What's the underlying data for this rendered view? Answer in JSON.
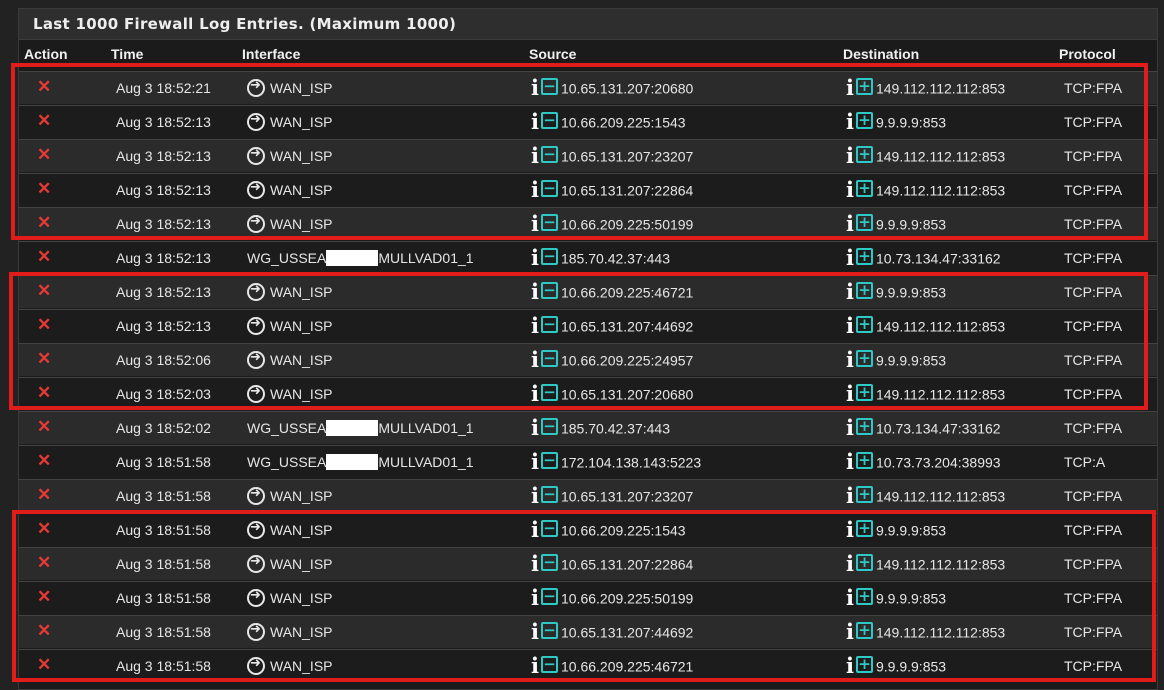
{
  "panel": {
    "title": "Last 1000 Firewall Log Entries. (Maximum 1000)"
  },
  "columns": {
    "action": "Action",
    "time": "Time",
    "interface": "Interface",
    "source": "Source",
    "destination": "Destination",
    "protocol": "Protocol"
  },
  "icons": {
    "action": "block-x-icon",
    "interface": "arrow-circle-icon",
    "info": "info-icon",
    "source": "minus-box-icon",
    "destination": "plus-box-icon"
  },
  "colors": {
    "block": "#e53935",
    "accent": "#2ec9c4",
    "highlight": "#e21b1b"
  },
  "rows": [
    {
      "time": "Aug 3 18:52:21",
      "iface": "WAN_ISP",
      "src": "10.65.131.207:20680",
      "dst": "149.112.112.112:853",
      "proto": "TCP:FPA"
    },
    {
      "time": "Aug 3 18:52:13",
      "iface": "WAN_ISP",
      "src": "10.66.209.225:1543",
      "dst": "9.9.9.9:853",
      "proto": "TCP:FPA"
    },
    {
      "time": "Aug 3 18:52:13",
      "iface": "WAN_ISP",
      "src": "10.65.131.207:23207",
      "dst": "149.112.112.112:853",
      "proto": "TCP:FPA"
    },
    {
      "time": "Aug 3 18:52:13",
      "iface": "WAN_ISP",
      "src": "10.65.131.207:22864",
      "dst": "149.112.112.112:853",
      "proto": "TCP:FPA"
    },
    {
      "time": "Aug 3 18:52:13",
      "iface": "WAN_ISP",
      "src": "10.66.209.225:50199",
      "dst": "9.9.9.9:853",
      "proto": "TCP:FPA"
    },
    {
      "time": "Aug 3 18:52:13",
      "iface_a": "WG_USSEA",
      "iface_b": "MULLVAD01_1",
      "src": "185.70.42.37:443",
      "dst": "10.73.134.47:33162",
      "proto": "TCP:FPA"
    },
    {
      "time": "Aug 3 18:52:13",
      "iface": "WAN_ISP",
      "src": "10.66.209.225:46721",
      "dst": "9.9.9.9:853",
      "proto": "TCP:FPA"
    },
    {
      "time": "Aug 3 18:52:13",
      "iface": "WAN_ISP",
      "src": "10.65.131.207:44692",
      "dst": "149.112.112.112:853",
      "proto": "TCP:FPA"
    },
    {
      "time": "Aug 3 18:52:06",
      "iface": "WAN_ISP",
      "src": "10.66.209.225:24957",
      "dst": "9.9.9.9:853",
      "proto": "TCP:FPA"
    },
    {
      "time": "Aug 3 18:52:03",
      "iface": "WAN_ISP",
      "src": "10.65.131.207:20680",
      "dst": "149.112.112.112:853",
      "proto": "TCP:FPA"
    },
    {
      "time": "Aug 3 18:52:02",
      "iface_a": "WG_USSEA",
      "iface_b": "MULLVAD01_1",
      "src": "185.70.42.37:443",
      "dst": "10.73.134.47:33162",
      "proto": "TCP:FPA"
    },
    {
      "time": "Aug 3 18:51:58",
      "iface_a": "WG_USSEA",
      "iface_b": "MULLVAD01_1",
      "src": "172.104.138.143:5223",
      "dst": "10.73.73.204:38993",
      "proto": "TCP:A"
    },
    {
      "time": "Aug 3 18:51:58",
      "iface": "WAN_ISP",
      "src": "10.65.131.207:23207",
      "dst": "149.112.112.112:853",
      "proto": "TCP:FPA"
    },
    {
      "time": "Aug 3 18:51:58",
      "iface": "WAN_ISP",
      "src": "10.66.209.225:1543",
      "dst": "9.9.9.9:853",
      "proto": "TCP:FPA"
    },
    {
      "time": "Aug 3 18:51:58",
      "iface": "WAN_ISP",
      "src": "10.65.131.207:22864",
      "dst": "149.112.112.112:853",
      "proto": "TCP:FPA"
    },
    {
      "time": "Aug 3 18:51:58",
      "iface": "WAN_ISP",
      "src": "10.66.209.225:50199",
      "dst": "9.9.9.9:853",
      "proto": "TCP:FPA"
    },
    {
      "time": "Aug 3 18:51:58",
      "iface": "WAN_ISP",
      "src": "10.65.131.207:44692",
      "dst": "149.112.112.112:853",
      "proto": "TCP:FPA"
    },
    {
      "time": "Aug 3 18:51:58",
      "iface": "WAN_ISP",
      "src": "10.66.209.225:46721",
      "dst": "9.9.9.9:853",
      "proto": "TCP:FPA"
    }
  ]
}
